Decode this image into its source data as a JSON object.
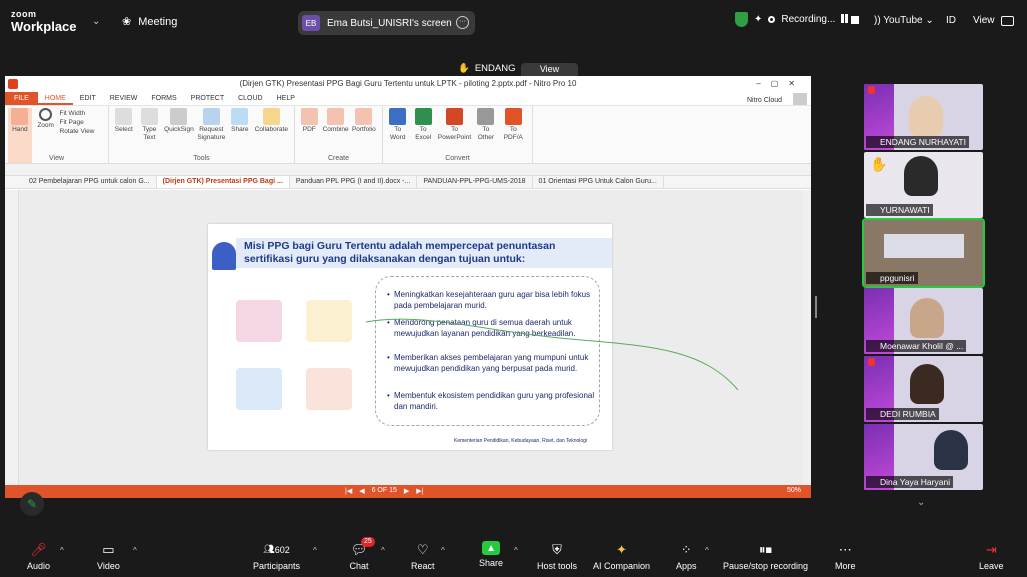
{
  "topbar": {
    "brand_small": "zoom",
    "brand_main": "Workplace",
    "meeting_label": "Meeting",
    "screen_initials": "EB",
    "screen_label": "Ema Butsi_UNISRI's screen",
    "recording_label": "Recording...",
    "youtube_label": "YouTube",
    "lang_label": "ID",
    "view_label": "View"
  },
  "floating": {
    "raised_name": "ENDANG",
    "view_button": "View"
  },
  "nitro": {
    "window_title": "(Dirjen GTK) Presentasi PPG Bagi Guru Tertentu untuk LPTK - piloting 2.pptx.pdf - Nitro Pro 10",
    "menu": [
      "FILE",
      "HOME",
      "EDIT",
      "REVIEW",
      "FORMS",
      "PROTECT",
      "CLOUD",
      "HELP"
    ],
    "account_label": "Nitro Cloud",
    "ribbon": {
      "view_group": "View",
      "tools_group": "Tools",
      "create_group": "Create",
      "convert_group": "Convert",
      "hand": "Hand",
      "zoom": "Zoom",
      "fit_width": "Fit Width",
      "fit_page": "Fit Page",
      "rotate_view": "Rotate View",
      "select": "Select",
      "type_text": "Type Text",
      "quicksign": "QuickSign",
      "request_signature": "Request Signature",
      "share": "Share",
      "collaborate": "Collaborate",
      "pdf": "PDF",
      "combine": "Combine",
      "portfolio": "Portfolio",
      "to_word": "To Word",
      "to_excel": "To Excel",
      "to_powerpoint": "To PowerPoint",
      "to_other": "To Other",
      "to_pdfa": "To PDF/A"
    },
    "tabs": [
      "02 Pembelajaran PPG untuk calon G...",
      "(Dirjen GTK) Presentasi PPG Bagi ...",
      "Panduan PPL PPG (I and II).docx -...",
      "PANDUAN-PPL-PPG-UMS-2018",
      "01 Orientasi PPG Untuk Calon Guru..."
    ],
    "page_indicator": "6 OF 15",
    "zoom_level": "50%"
  },
  "slide": {
    "heading": "Misi PPG bagi Guru Tertentu adalah mempercepat penuntasan sertifikasi guru yang dilaksanakan dengan tujuan untuk:",
    "bullets": [
      "Meningkatkan kesejahteraan guru agar bisa lebih fokus pada pembelajaran murid.",
      "Mendorong penataan guru di semua daerah untuk mewujudkan layanan pendidikan yang berkeadilan.",
      "Memberikan akses pembelajaran yang mumpuni untuk mewujudkan pendidikan yang berpusat pada murid.",
      "Membentuk ekosistem pendidikan guru yang profesional dan mandiri."
    ],
    "footer": "Kementerian Pendidikan, Kebudayaan, Riset, dan Teknologi"
  },
  "participants": [
    {
      "name": "ENDANG NURHAYATI"
    },
    {
      "name": "YURNAWATI"
    },
    {
      "name": "ppgunisri"
    },
    {
      "name": "Moenawar Kholil @ ..."
    },
    {
      "name": "DEDI RUMBIA"
    },
    {
      "name": "Dina Yaya Haryani"
    }
  ],
  "bottombar": {
    "audio": "Audio",
    "video": "Video",
    "participants": "Participants",
    "participant_count": "602",
    "chat": "Chat",
    "chat_badge": "25",
    "react": "React",
    "share": "Share",
    "host_tools": "Host tools",
    "ai_companion": "AI Companion",
    "apps": "Apps",
    "pause_stop": "Pause/stop recording",
    "more": "More",
    "leave": "Leave"
  },
  "colors": {
    "accent": "#e0542a",
    "share_green": "#27c93f",
    "zoom_bg": "#1a1a1a"
  }
}
